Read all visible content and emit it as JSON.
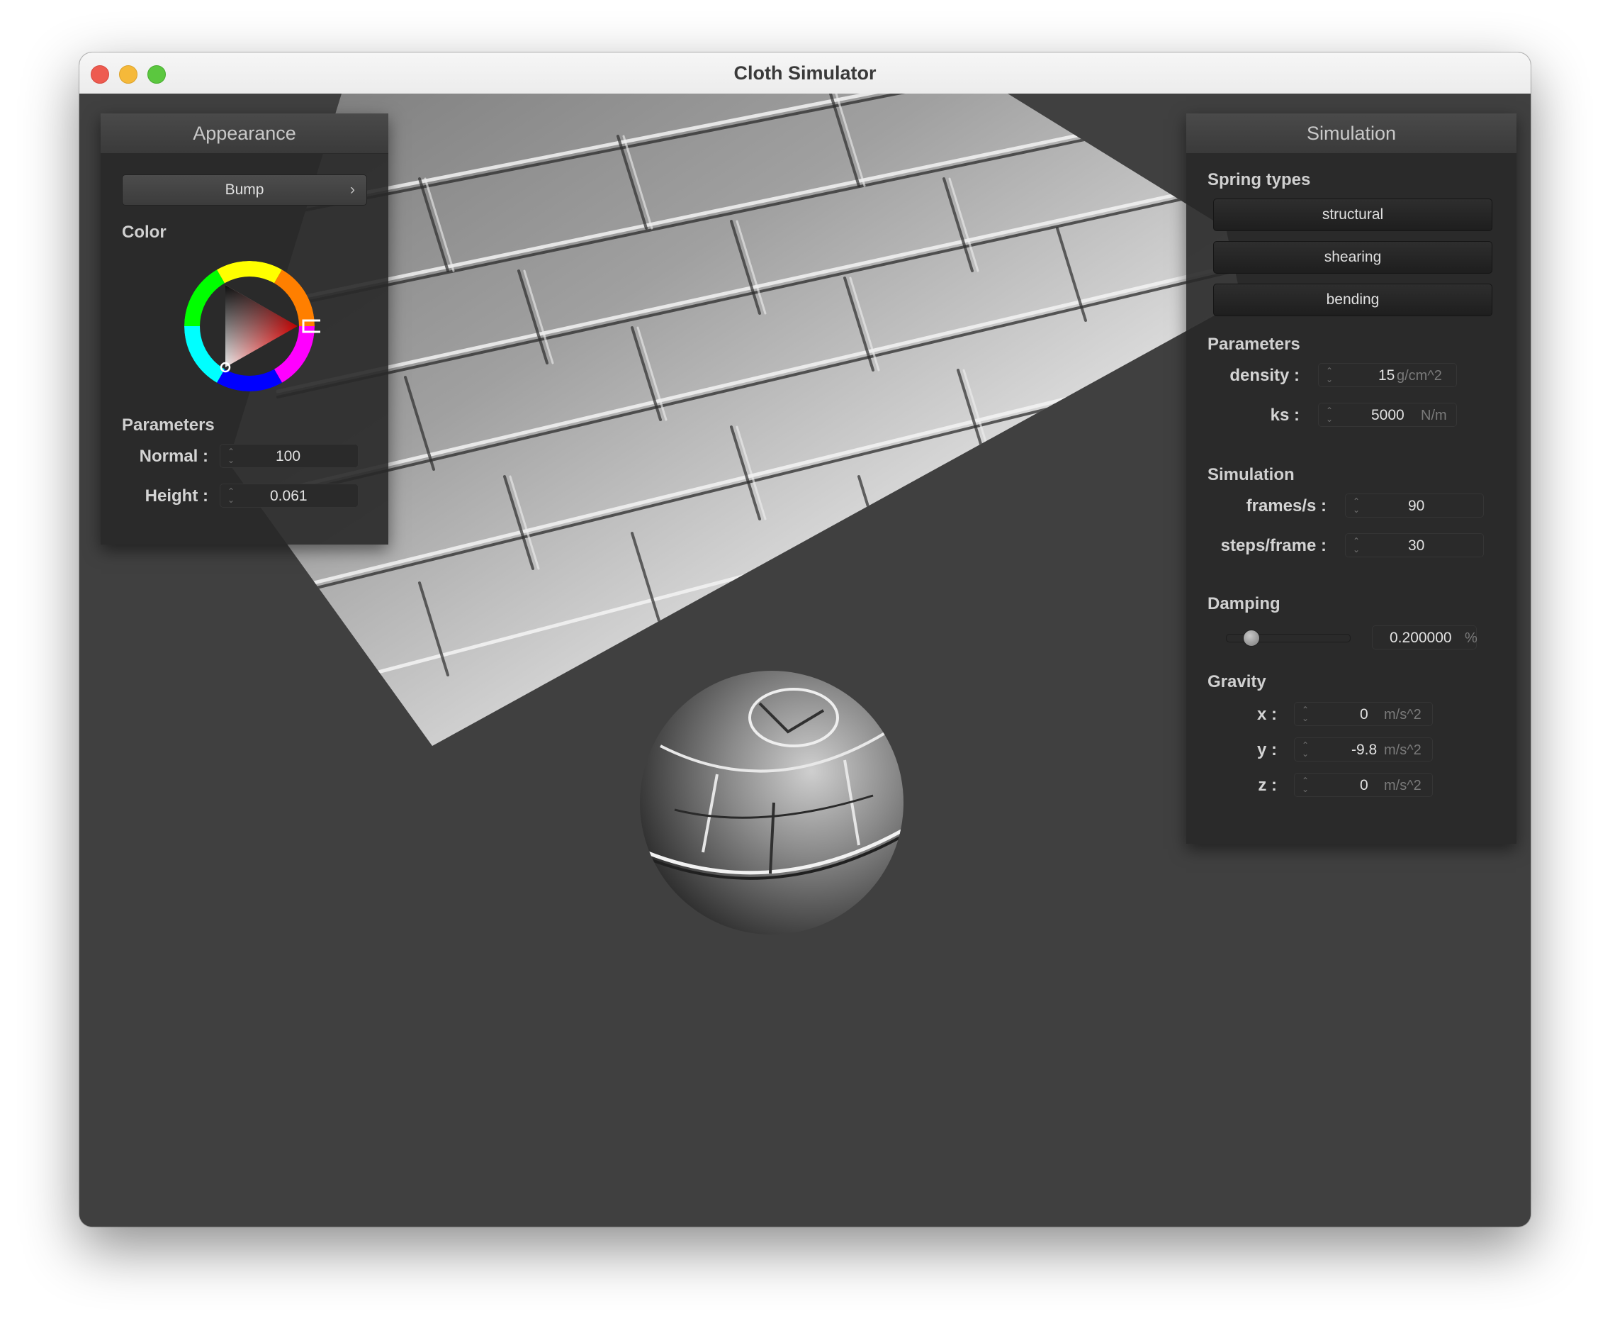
{
  "window": {
    "title": "Cloth Simulator"
  },
  "appearance": {
    "header": "Appearance",
    "shader_select": "Bump",
    "shader_chevron": "›",
    "color_label": "Color",
    "parameters_label": "Parameters",
    "normal_label": "Normal :",
    "normal_value": "100",
    "height_label": "Height :",
    "height_value": "0.061",
    "color_picker_hue": "#ff0000"
  },
  "simulation": {
    "header": "Simulation",
    "spring_types_label": "Spring types",
    "spring_types": [
      "structural",
      "shearing",
      "bending"
    ],
    "parameters_label": "Parameters",
    "density_label": "density :",
    "density_value": "15",
    "density_unit": "g/cm^2",
    "ks_label": "ks :",
    "ks_value": "5000",
    "ks_unit": "N/m",
    "simulation_label": "Simulation",
    "fps_label": "frames/s :",
    "fps_value": "90",
    "steps_label": "steps/frame :",
    "steps_value": "30",
    "damping_label": "Damping",
    "damping_value": "0.200000",
    "damping_unit": "%",
    "damping_fraction": 0.2,
    "gravity_label": "Gravity",
    "gravity": [
      {
        "label": "x :",
        "value": "0",
        "unit": "m/s^2"
      },
      {
        "label": "y :",
        "value": "-9.8",
        "unit": "m/s^2"
      },
      {
        "label": "z :",
        "value": "0",
        "unit": "m/s^2"
      }
    ]
  }
}
